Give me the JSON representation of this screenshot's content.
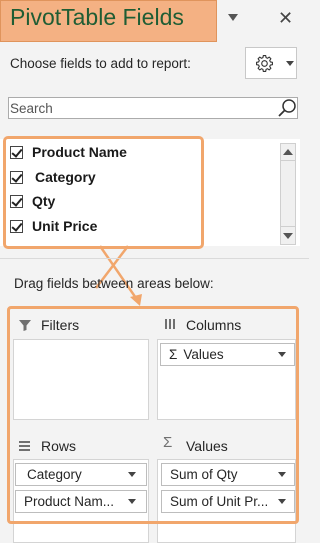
{
  "header": {
    "title": "PivotTable Fields"
  },
  "toolbar": {
    "choose_label": "Choose fields to add to report:"
  },
  "search": {
    "placeholder": "Search"
  },
  "fields": [
    {
      "label": "Product Name",
      "checked": true
    },
    {
      "label": "Category",
      "checked": true
    },
    {
      "label": "Qty",
      "checked": true
    },
    {
      "label": "Unit Price",
      "checked": true
    }
  ],
  "areas": {
    "drag_hint": "Drag fields between areas below:",
    "filters": {
      "label": "Filters",
      "items": []
    },
    "columns": {
      "label": "Columns",
      "items": [
        "Values"
      ]
    },
    "rows": {
      "label": "Rows",
      "items": [
        "Category",
        "Product Nam..."
      ]
    },
    "values": {
      "label": "Values",
      "items": [
        "Sum of Qty",
        "Sum of Unit Pr..."
      ]
    }
  },
  "colors": {
    "highlight": "#f1a66c",
    "title_bg": "#f4b183",
    "title_text": "#1f5d34"
  }
}
